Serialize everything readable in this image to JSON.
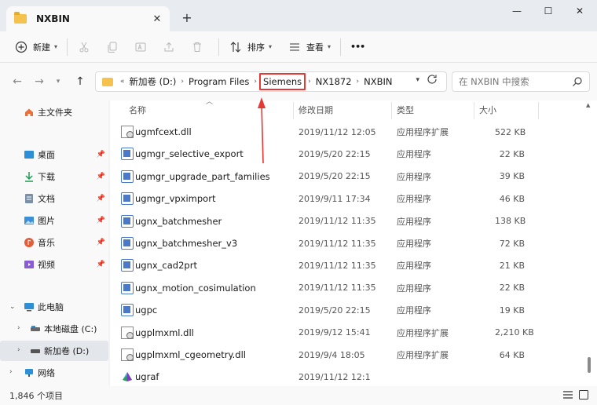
{
  "tab": {
    "title": "NXBIN",
    "close": "✕",
    "new": "+"
  },
  "window": {
    "minimize": "—",
    "maximize": "☐",
    "close": "✕"
  },
  "toolbar": {
    "new_label": "新建",
    "sort_label": "排序",
    "view_label": "查看",
    "more_label": "•••"
  },
  "address": {
    "overflow": "«",
    "crumbs": [
      "新加卷 (D:)",
      "Program Files",
      "Siemens",
      "NX1872",
      "NXBIN"
    ],
    "search_placeholder": "在 NXBIN 中搜索"
  },
  "sidebar": {
    "home": "主文件夹",
    "quick": [
      {
        "label": "桌面"
      },
      {
        "label": "下载"
      },
      {
        "label": "文档"
      },
      {
        "label": "图片"
      },
      {
        "label": "音乐"
      },
      {
        "label": "视频"
      }
    ],
    "this_pc": "此电脑",
    "drive_c": "本地磁盘 (C:)",
    "drive_d": "新加卷 (D:)",
    "network": "网络"
  },
  "columns": {
    "name": "名称",
    "date": "修改日期",
    "type": "类型",
    "size": "大小"
  },
  "files": [
    {
      "name": "ugmfcext.dll",
      "date": "2019/11/12 12:05",
      "type": "应用程序扩展",
      "size": "522 KB",
      "icon": "dll-icon"
    },
    {
      "name": "ugmgr_selective_export",
      "date": "2019/5/20 22:15",
      "type": "应用程序",
      "size": "22 KB",
      "icon": "exe-icon"
    },
    {
      "name": "ugmgr_upgrade_part_families",
      "date": "2019/5/20 22:15",
      "type": "应用程序",
      "size": "39 KB",
      "icon": "exe-icon"
    },
    {
      "name": "ugmgr_vpximport",
      "date": "2019/9/11 17:34",
      "type": "应用程序",
      "size": "46 KB",
      "icon": "exe-icon"
    },
    {
      "name": "ugnx_batchmesher",
      "date": "2019/11/12 11:35",
      "type": "应用程序",
      "size": "138 KB",
      "icon": "exe-icon"
    },
    {
      "name": "ugnx_batchmesher_v3",
      "date": "2019/11/12 11:35",
      "type": "应用程序",
      "size": "72 KB",
      "icon": "exe-icon"
    },
    {
      "name": "ugnx_cad2prt",
      "date": "2019/11/12 11:35",
      "type": "应用程序",
      "size": "21 KB",
      "icon": "exe-icon"
    },
    {
      "name": "ugnx_motion_cosimulation",
      "date": "2019/11/12 11:35",
      "type": "应用程序",
      "size": "22 KB",
      "icon": "exe-icon"
    },
    {
      "name": "ugpc",
      "date": "2019/5/20 22:15",
      "type": "应用程序",
      "size": "19 KB",
      "icon": "exe-icon"
    },
    {
      "name": "ugplmxml.dll",
      "date": "2019/9/12 15:41",
      "type": "应用程序扩展",
      "size": "2,210 KB",
      "icon": "dll-icon"
    },
    {
      "name": "ugplmxml_cgeometry.dll",
      "date": "2019/9/4 18:05",
      "type": "应用程序扩展",
      "size": "64 KB",
      "icon": "dll-icon"
    },
    {
      "name": "ugraf",
      "date": "2019/11/12 12:1",
      "type": "",
      "size": "",
      "icon": "nx-app-icon"
    }
  ],
  "status": {
    "count": "1,846 个项目"
  },
  "colors": {
    "accent": "#4a79c9",
    "highlight": "#e53935",
    "folder": "#f4c24d"
  }
}
